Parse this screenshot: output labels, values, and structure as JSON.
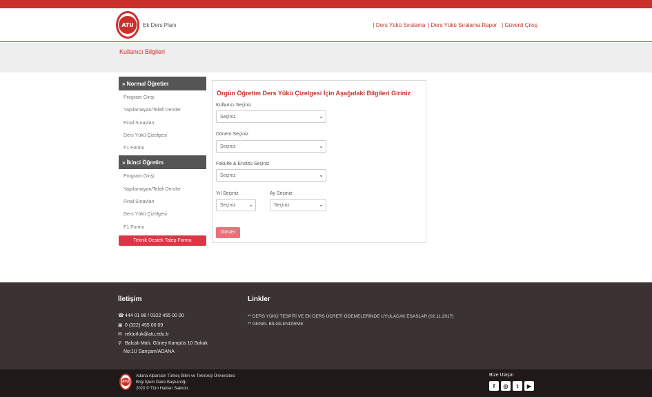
{
  "header": {
    "logo_text": "ATU",
    "app_title": "Ek Ders Planı",
    "nav": [
      {
        "label": "| Ders Yükü Sıralama"
      },
      {
        "label": "| Ders Yükü Sıralama Rapor"
      },
      {
        "label": "| Güvenli Çıkış"
      }
    ]
  },
  "subheader": {
    "title": "Kullanıcı Bilgileri"
  },
  "sidebar": {
    "sections": [
      {
        "heading": "» Normal Öğretim",
        "items": [
          "Program Girişi",
          "Yapılamayan/Telafi Dersler",
          "Final Sınavları",
          "Ders Yükü Çizelgesi",
          "F1 Formu"
        ]
      },
      {
        "heading": "» İkinci Öğretim",
        "items": [
          "Program Girişi",
          "Yapılamayan/Telafi Dersler",
          "Final Sınavları",
          "Ders Yükü Çizelgesi",
          "F1 Formu"
        ]
      }
    ],
    "support_button": "Teknik Destek Talep Formu"
  },
  "form": {
    "title": "Örgün Öğretim Ders Yükü Çizelgesi İçin Aşağıdaki Bilgileri Giriniz",
    "user_label": "Kullanıcı Seçiniz",
    "user_value": "Seçiniz",
    "term_label": "Dönem Seçiniz",
    "term_value": "Seçiniz",
    "faculty_label": "Fakülte & Enstitü Seçiniz",
    "faculty_value": "Seçiniz",
    "year_label": "Yıl Seçiniz",
    "year_value": "Seçiniz",
    "month_label": "Ay Seçiniz",
    "month_value": "Seçiniz",
    "submit_label": "Göster"
  },
  "footer": {
    "contact_heading": "İletişim",
    "phone": "444 01 88  / 0322 455 00 00",
    "fax": "0 (322) 455 00 09",
    "email": "rektorluk@atu.edu.tr",
    "address_line1": "Balcalı Mah. Güney Kampüs 10 Sokak",
    "address_line2": "No:1U Sarıçam/ADANA",
    "links_heading": "Linkler",
    "links": [
      "** DERS YÜKÜ TESPİTİ VE EK DERS ÜCRETİ ÖDEMELERİNDE UYULACAK ESASLAR (02.11.2017)",
      "** GENEL BİLGİLENDİRME"
    ]
  },
  "bottom": {
    "logo_text": "ATU",
    "org_line1": "Adana Alparslan Türkeş Bilim ve Teknoloji Üniversitesi",
    "org_line2": "Bilgi İşlem Daire Başkanlığı",
    "org_line3": "2020 © Tüm Hakları Saklıdır.",
    "reach_label": "Bize Ulaşın",
    "social_icons": [
      "facebook-icon",
      "instagram-icon",
      "twitter-icon",
      "youtube-icon"
    ]
  }
}
